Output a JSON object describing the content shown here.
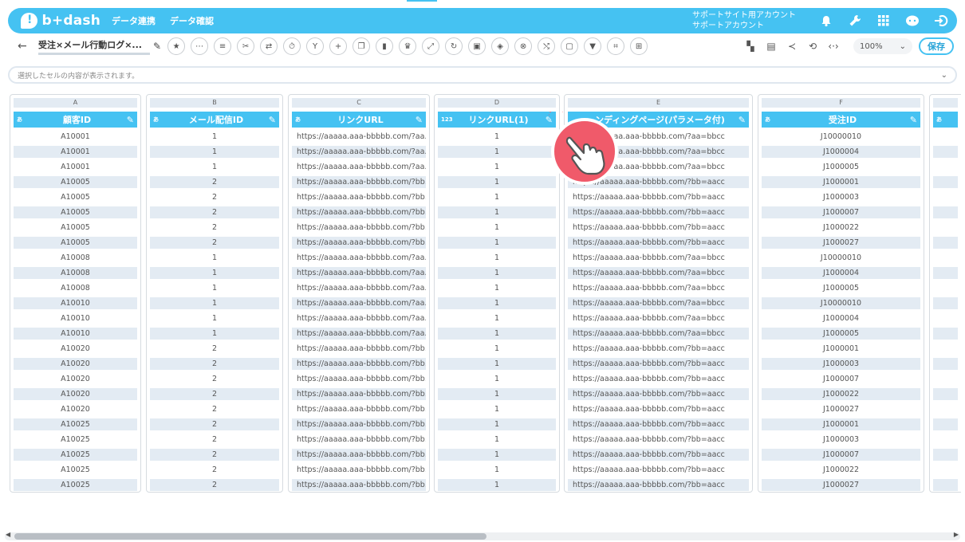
{
  "app": {
    "logo": "b+dash",
    "nav": [
      "データ連携",
      "データ確認"
    ],
    "account_line1": "サポートサイト用アカウント",
    "account_line2": "サポートアカウント"
  },
  "toolbar": {
    "doc_title": "受注×メール行動ログ×...",
    "zoom": "100%",
    "save_label": "保存"
  },
  "cell_info": {
    "placeholder": "選択したセルの内容が表示されます。"
  },
  "columns": [
    {
      "letter": "A",
      "name": "顧客ID",
      "type": "あ"
    },
    {
      "letter": "B",
      "name": "メール配信ID",
      "type": "あ"
    },
    {
      "letter": "C",
      "name": "リンクURL",
      "type": "あ"
    },
    {
      "letter": "D",
      "name": "リンクURL(1)",
      "type": "123"
    },
    {
      "letter": "E",
      "name": "ンディングページ(パラメータ付)",
      "type": ""
    },
    {
      "letter": "F",
      "name": "受注ID",
      "type": "あ"
    },
    {
      "letter": "",
      "name": "",
      "type": "あ"
    }
  ],
  "rows": [
    [
      "A10001",
      "1",
      "https://aaaaa.aaa-bbbbb.com/?aa...",
      "1",
      "https://aaaaa.aaa-bbbbb.com/?aa=bbcc",
      "J10000010"
    ],
    [
      "A10001",
      "1",
      "https://aaaaa.aaa-bbbbb.com/?aa...",
      "1",
      "https://aaaaa.aaa-bbbbb.com/?aa=bbcc",
      "J1000004"
    ],
    [
      "A10001",
      "1",
      "https://aaaaa.aaa-bbbbb.com/?aa...",
      "1",
      "https://aaaaa.aaa-bbbbb.com/?aa=bbcc",
      "J1000005"
    ],
    [
      "A10005",
      "2",
      "https://aaaaa.aaa-bbbbb.com/?bb...",
      "1",
      "https://aaaaa.aaa-bbbbb.com/?bb=aacc",
      "J1000001"
    ],
    [
      "A10005",
      "2",
      "https://aaaaa.aaa-bbbbb.com/?bb...",
      "1",
      "https://aaaaa.aaa-bbbbb.com/?bb=aacc",
      "J1000003"
    ],
    [
      "A10005",
      "2",
      "https://aaaaa.aaa-bbbbb.com/?bb...",
      "1",
      "https://aaaaa.aaa-bbbbb.com/?bb=aacc",
      "J1000007"
    ],
    [
      "A10005",
      "2",
      "https://aaaaa.aaa-bbbbb.com/?bb...",
      "1",
      "https://aaaaa.aaa-bbbbb.com/?bb=aacc",
      "J1000022"
    ],
    [
      "A10005",
      "2",
      "https://aaaaa.aaa-bbbbb.com/?bb...",
      "1",
      "https://aaaaa.aaa-bbbbb.com/?bb=aacc",
      "J1000027"
    ],
    [
      "A10008",
      "1",
      "https://aaaaa.aaa-bbbbb.com/?aa...",
      "1",
      "https://aaaaa.aaa-bbbbb.com/?aa=bbcc",
      "J10000010"
    ],
    [
      "A10008",
      "1",
      "https://aaaaa.aaa-bbbbb.com/?aa...",
      "1",
      "https://aaaaa.aaa-bbbbb.com/?aa=bbcc",
      "J1000004"
    ],
    [
      "A10008",
      "1",
      "https://aaaaa.aaa-bbbbb.com/?aa...",
      "1",
      "https://aaaaa.aaa-bbbbb.com/?aa=bbcc",
      "J1000005"
    ],
    [
      "A10010",
      "1",
      "https://aaaaa.aaa-bbbbb.com/?aa...",
      "1",
      "https://aaaaa.aaa-bbbbb.com/?aa=bbcc",
      "J10000010"
    ],
    [
      "A10010",
      "1",
      "https://aaaaa.aaa-bbbbb.com/?aa...",
      "1",
      "https://aaaaa.aaa-bbbbb.com/?aa=bbcc",
      "J1000004"
    ],
    [
      "A10010",
      "1",
      "https://aaaaa.aaa-bbbbb.com/?aa...",
      "1",
      "https://aaaaa.aaa-bbbbb.com/?aa=bbcc",
      "J1000005"
    ],
    [
      "A10020",
      "2",
      "https://aaaaa.aaa-bbbbb.com/?bb...",
      "1",
      "https://aaaaa.aaa-bbbbb.com/?bb=aacc",
      "J1000001"
    ],
    [
      "A10020",
      "2",
      "https://aaaaa.aaa-bbbbb.com/?bb...",
      "1",
      "https://aaaaa.aaa-bbbbb.com/?bb=aacc",
      "J1000003"
    ],
    [
      "A10020",
      "2",
      "https://aaaaa.aaa-bbbbb.com/?bb...",
      "1",
      "https://aaaaa.aaa-bbbbb.com/?bb=aacc",
      "J1000007"
    ],
    [
      "A10020",
      "2",
      "https://aaaaa.aaa-bbbbb.com/?bb...",
      "1",
      "https://aaaaa.aaa-bbbbb.com/?bb=aacc",
      "J1000022"
    ],
    [
      "A10020",
      "2",
      "https://aaaaa.aaa-bbbbb.com/?bb...",
      "1",
      "https://aaaaa.aaa-bbbbb.com/?bb=aacc",
      "J1000027"
    ],
    [
      "A10025",
      "2",
      "https://aaaaa.aaa-bbbbb.com/?bb...",
      "1",
      "https://aaaaa.aaa-bbbbb.com/?bb=aacc",
      "J1000001"
    ],
    [
      "A10025",
      "2",
      "https://aaaaa.aaa-bbbbb.com/?bb...",
      "1",
      "https://aaaaa.aaa-bbbbb.com/?bb=aacc",
      "J1000003"
    ],
    [
      "A10025",
      "2",
      "https://aaaaa.aaa-bbbbb.com/?bb...",
      "1",
      "https://aaaaa.aaa-bbbbb.com/?bb=aacc",
      "J1000007"
    ],
    [
      "A10025",
      "2",
      "https://aaaaa.aaa-bbbbb.com/?bb...",
      "1",
      "https://aaaaa.aaa-bbbbb.com/?bb=aacc",
      "J1000022"
    ],
    [
      "A10025",
      "2",
      "https://aaaaa.aaa-bbbbb.com/?bb...",
      "1",
      "https://aaaaa.aaa-bbbbb.com/?bb=aacc",
      "J1000027"
    ]
  ],
  "colors": {
    "accent": "#45c2f2",
    "row_alt": "#e3ebf3",
    "cursor_ring": "#f05a6a"
  }
}
